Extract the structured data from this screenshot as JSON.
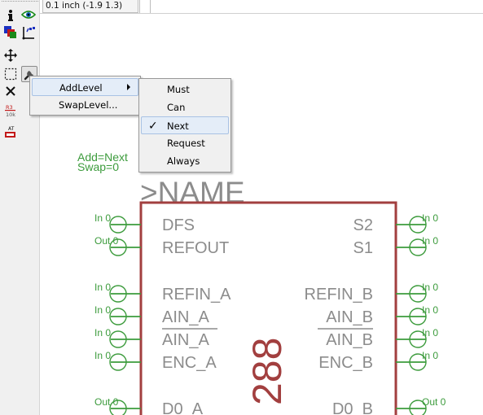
{
  "status_bar": {
    "coordinate_readout": "0.1 inch (-1.9 1.3)"
  },
  "toolbar": {
    "tools": [
      {
        "name": "info-icon",
        "active": false
      },
      {
        "name": "show-icon",
        "active": false
      },
      {
        "name": "display-layers-icon",
        "active": false
      },
      {
        "name": "mark-icon",
        "active": false
      },
      {
        "name": "move-icon",
        "active": false
      },
      {
        "name": "group-icon",
        "active": false
      },
      {
        "name": "change-icon",
        "active": true
      },
      {
        "name": "delete-icon",
        "active": false
      },
      {
        "name": "value-icon",
        "active": false
      },
      {
        "name": "attribute-icon",
        "active": false
      }
    ],
    "value_icon_text": {
      "top": "R3",
      "bottom": "10k"
    },
    "attribute_icon_text": "AT"
  },
  "context_menu": {
    "items": [
      {
        "label": "AddLevel",
        "has_submenu": true,
        "highlighted": true
      },
      {
        "label": "SwapLevel...",
        "has_submenu": false,
        "highlighted": false
      }
    ]
  },
  "submenu": {
    "items": [
      {
        "label": "Must",
        "checked": false,
        "highlighted": false
      },
      {
        "label": "Can",
        "checked": false,
        "highlighted": false
      },
      {
        "label": "Next",
        "checked": true,
        "highlighted": true
      },
      {
        "label": "Request",
        "checked": false,
        "highlighted": false
      },
      {
        "label": "Always",
        "checked": false,
        "highlighted": false
      }
    ]
  },
  "schematic": {
    "gate_info": {
      "add": "Add=Next",
      "swap": "Swap=0"
    },
    "name_placeholder": ">NAME",
    "value_placeholder_partial": "288",
    "left_pins": [
      {
        "name": "DFS",
        "direction": "In",
        "swap": "0",
        "overbar": false
      },
      {
        "name": "REFOUT",
        "direction": "Out",
        "swap": "0",
        "overbar": false
      },
      {
        "name": "REFIN_A",
        "direction": "In",
        "swap": "0",
        "overbar": false
      },
      {
        "name": "AIN_A",
        "direction": "In",
        "swap": "0",
        "overbar": false
      },
      {
        "name": "AIN_A",
        "direction": "In",
        "swap": "0",
        "overbar": true
      },
      {
        "name": "ENC_A",
        "direction": "In",
        "swap": "0",
        "overbar": false
      },
      {
        "name": "D0_A",
        "direction": "Out",
        "swap": "0",
        "overbar": false
      }
    ],
    "right_pins": [
      {
        "name": "S2",
        "direction": "In",
        "swap": "0",
        "overbar": false
      },
      {
        "name": "S1",
        "direction": "In",
        "swap": "0",
        "overbar": false
      },
      {
        "name": "REFIN_B",
        "direction": "In",
        "swap": "0",
        "overbar": false
      },
      {
        "name": "AIN_B",
        "direction": "In",
        "swap": "0",
        "overbar": false
      },
      {
        "name": "AIN_B",
        "direction": "In",
        "swap": "0",
        "overbar": true
      },
      {
        "name": "ENC_B",
        "direction": "In",
        "swap": "0",
        "overbar": false
      },
      {
        "name": "D0_B",
        "direction": "Out",
        "swap": "0",
        "overbar": false
      }
    ]
  },
  "colors": {
    "symbol_outline": "#a23f3f",
    "symbol_value_text": "#a23f3f",
    "pin_green": "#3c9b3c",
    "pin_label_gray": "#8c8c8c",
    "menu_bg": "#f0f0f0",
    "menu_highlight": "#e4edf8",
    "menu_highlight_border": "#a9c2e4"
  }
}
